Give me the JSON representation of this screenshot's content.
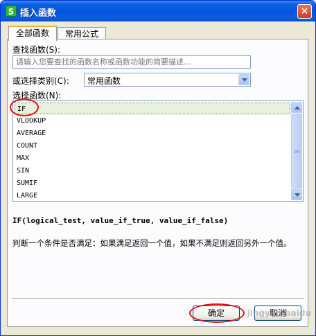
{
  "window": {
    "title": "插入函数",
    "app_icon_letter": "S",
    "close_symbol": "×"
  },
  "tabs": [
    {
      "label": "全部函数",
      "active": true
    },
    {
      "label": "常用公式",
      "active": false
    }
  ],
  "search": {
    "label": "查找函数(S):",
    "placeholder": "请输入您要查找的函数名称或函数功能的简要描述..."
  },
  "category": {
    "label": "或选择类别(C):",
    "value": "常用函数"
  },
  "functions": {
    "label": "选择函数(N):",
    "items": [
      "IF",
      "VLOOKUP",
      "AVERAGE",
      "COUNT",
      "MAX",
      "SIN",
      "SUMIF",
      "LARGE"
    ],
    "selected": "IF"
  },
  "signature": "IF(logical_test, value_if_true, value_if_false)",
  "description": "判断一个条件是否满足：如果满足返回一个值，如果不满足则返回另外一个值。",
  "buttons": {
    "ok": "确定",
    "cancel": "取消"
  },
  "watermark": "jingyan.baidu",
  "colors": {
    "titlebar": "#0454e4",
    "annotation": "#e01010",
    "selected_row": "#e8f0e0"
  }
}
